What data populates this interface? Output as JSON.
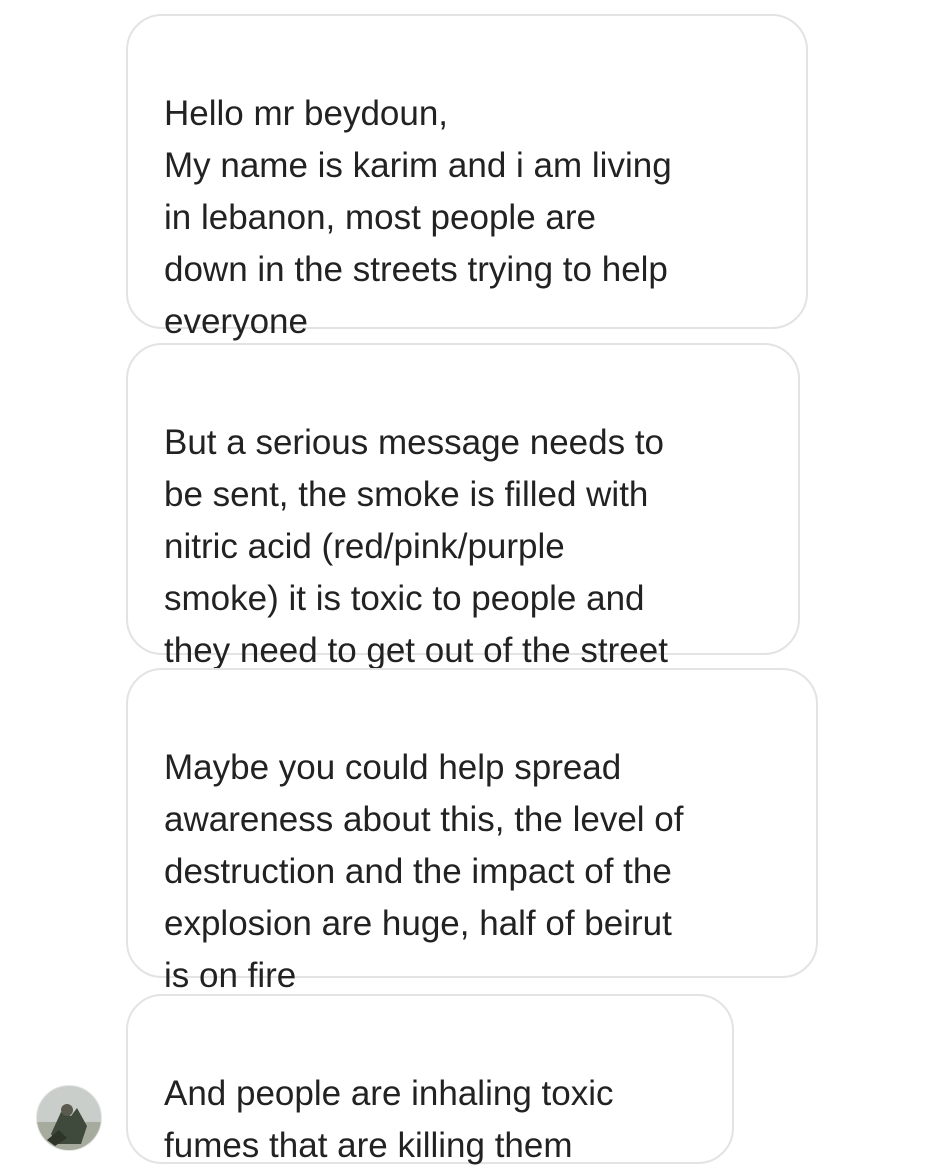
{
  "messages": [
    {
      "text": "Hello mr beydoun,\nMy name is karim and i am living\nin lebanon, most people are\ndown in the streets trying to help\neveryone"
    },
    {
      "text": "But a serious message needs to\nbe sent, the smoke is filled with\nnitric acid (red/pink/purple\nsmoke) it is toxic to people and\nthey need to get out of the street"
    },
    {
      "text": "Maybe you could help spread\nawareness about this, the level of\ndestruction and the impact of the\nexplosion are huge, half of beirut\nis on fire"
    },
    {
      "text": "And people are inhaling toxic\nfumes that are killing them"
    }
  ],
  "colors": {
    "bubble_border": "#e3e3e3",
    "text": "#222222",
    "background": "#ffffff"
  }
}
